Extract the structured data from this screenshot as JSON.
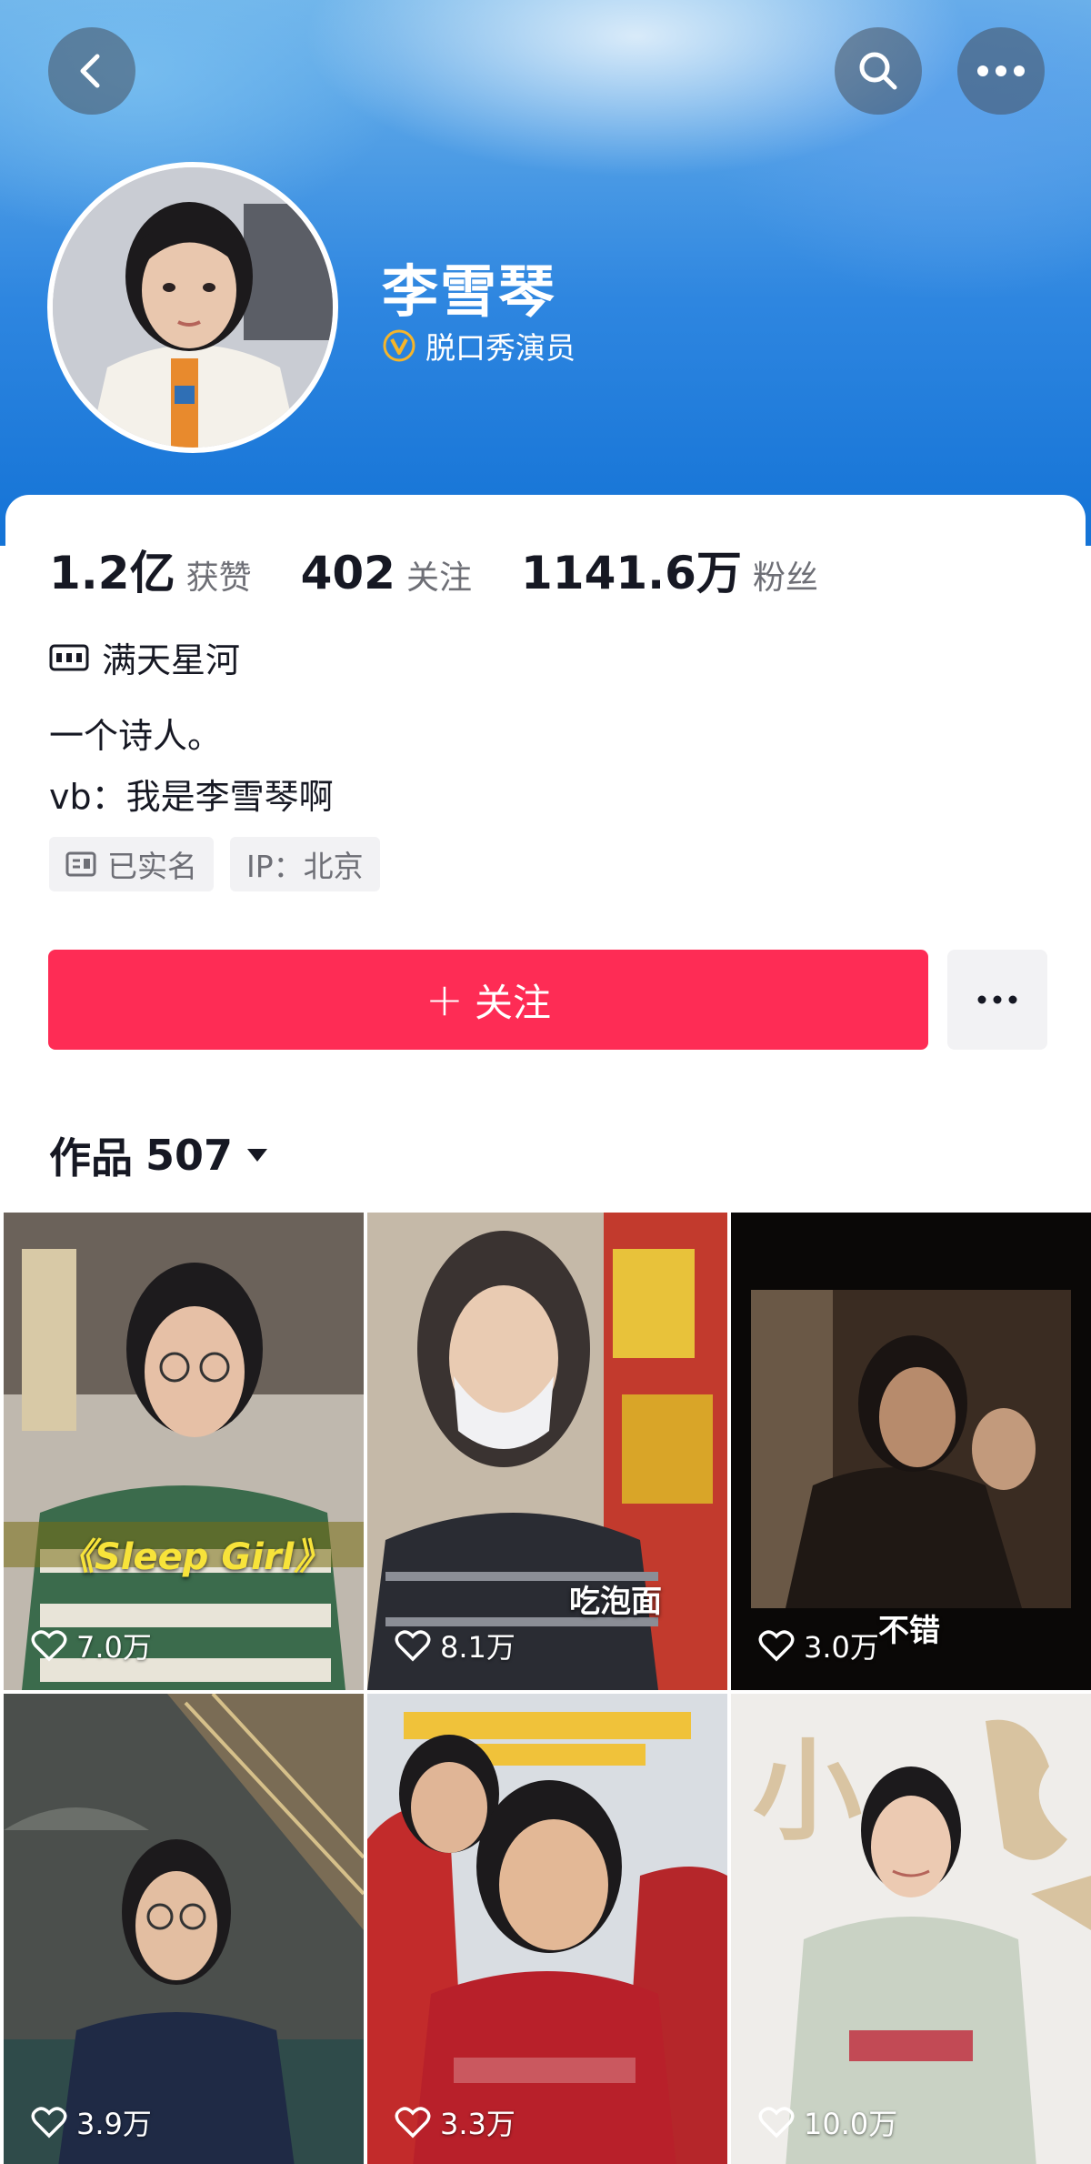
{
  "profile": {
    "name": "李雪琴",
    "verify_label": "脱口秀演员",
    "org": "满天星河",
    "bio_line1": "一个诗人。",
    "bio_line2": "vb：我是李雪琴啊",
    "tag_realname": "已实名",
    "tag_ip": "IP：北京"
  },
  "stats": {
    "likes_num": "1.2亿",
    "likes_label": "获赞",
    "following_num": "402",
    "following_label": "关注",
    "followers_num": "1141.6万",
    "followers_label": "粉丝"
  },
  "actions": {
    "follow_label": "关注",
    "follow_plus": "+"
  },
  "works": {
    "label": "作品",
    "count": "507"
  },
  "videos": [
    {
      "likes": "7.0万",
      "caption": "《Sleep Girl》"
    },
    {
      "likes": "8.1万",
      "caption": "吃泡面"
    },
    {
      "likes": "3.0万",
      "caption": "不错"
    },
    {
      "likes": "3.9万",
      "caption": ""
    },
    {
      "likes": "3.3万",
      "caption": ""
    },
    {
      "likes": "10.0万",
      "caption": "小"
    }
  ],
  "icons": [
    "back-icon",
    "search-icon",
    "more-icon",
    "verified-icon",
    "org-icon",
    "id-card-icon",
    "heart-icon",
    "caret-down-icon"
  ],
  "colors": {
    "accent": "#fe2c55",
    "banner": "#1473d6",
    "verify": "#f5b52a"
  }
}
